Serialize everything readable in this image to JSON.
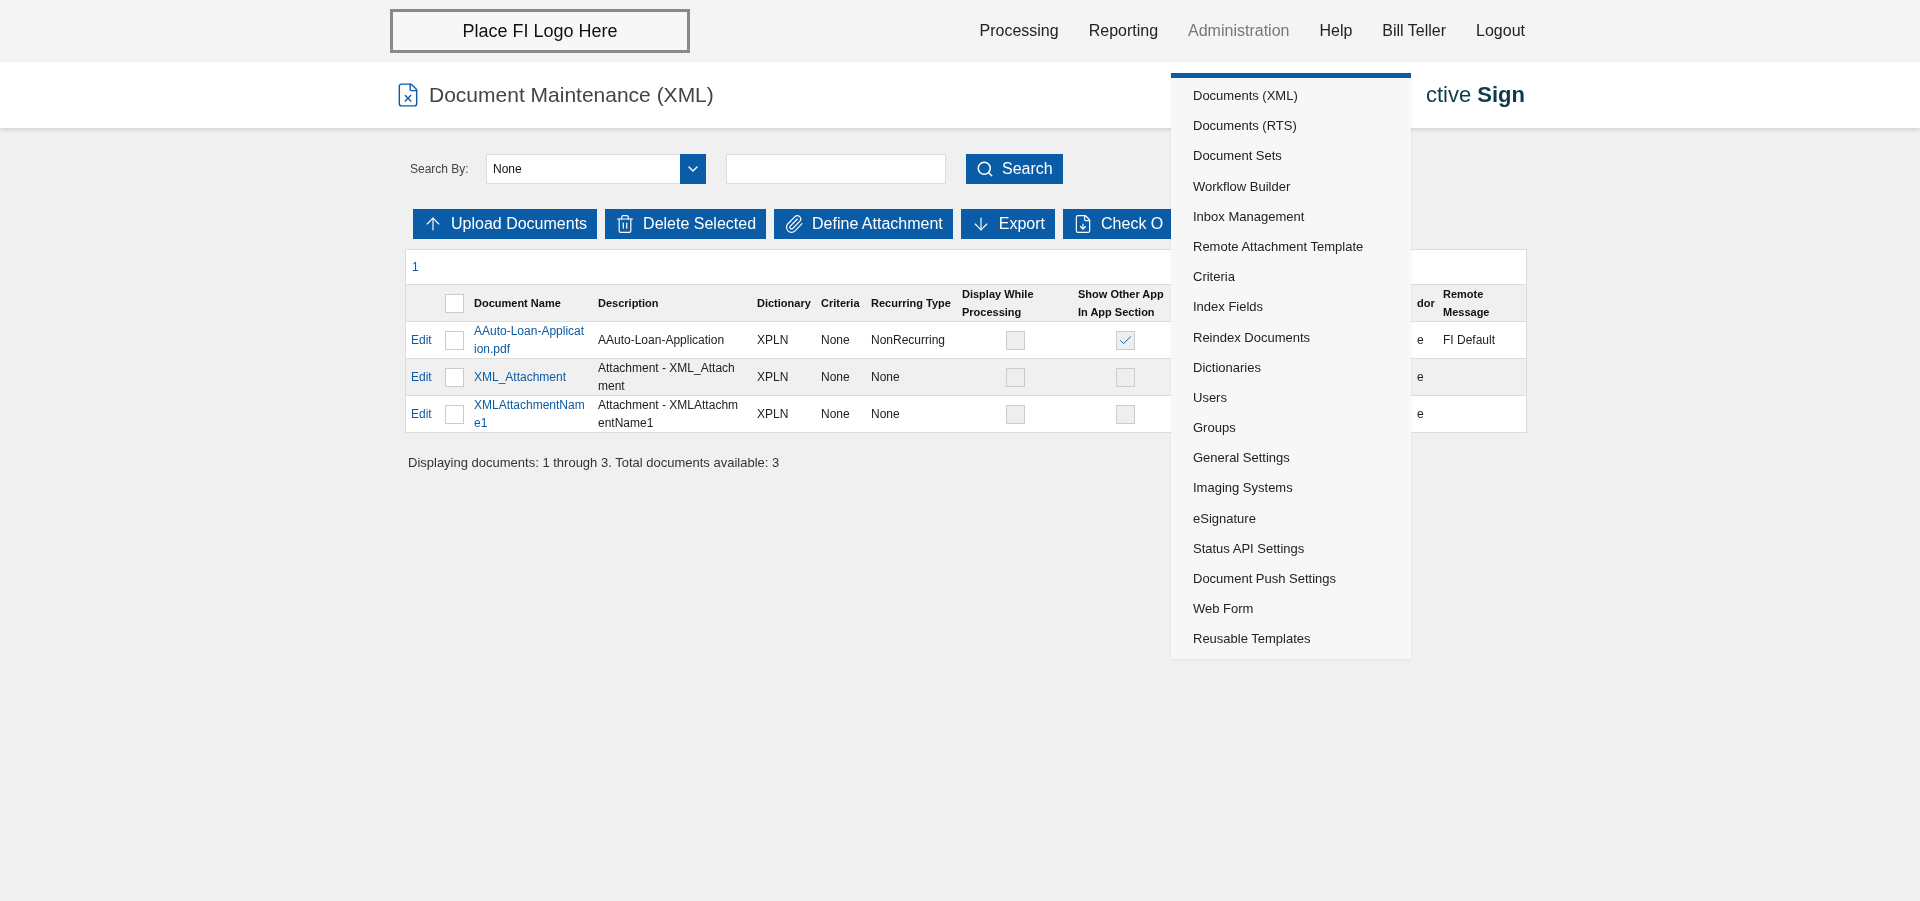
{
  "header": {
    "logo_text": "Place FI Logo Here",
    "nav": [
      {
        "label": "Processing",
        "selected": false
      },
      {
        "label": "Reporting",
        "selected": false
      },
      {
        "label": "Administration",
        "selected": true
      },
      {
        "label": "Help",
        "selected": false
      },
      {
        "label": "Bill Teller",
        "selected": false
      },
      {
        "label": "Logout",
        "selected": false
      }
    ]
  },
  "title_bar": {
    "title": "Document Maintenance (XML)",
    "brand": "ctive **Sign**"
  },
  "search": {
    "label": "Search By:",
    "select_value": "None",
    "button": "Search"
  },
  "toolbar": [
    {
      "label": "Upload Documents",
      "kind": "upload"
    },
    {
      "label": "Delete Selected",
      "kind": "delete"
    },
    {
      "label": "Define Attachment",
      "kind": "attach"
    },
    {
      "label": "Export",
      "kind": "export"
    },
    {
      "label": "Check O",
      "kind": "checkout"
    }
  ],
  "table": {
    "pager": "1",
    "select_all_checked": false,
    "columns": [
      "Document Name",
      "Description",
      "Dictionary",
      "Criteria",
      "Recurring Type",
      "Display While Processing",
      "Show Other App In App Section",
      "dor",
      "Remote Message"
    ],
    "rows": [
      {
        "edit": "Edit",
        "checked": false,
        "name": "AAuto-Loan-Applicat ion.pdf",
        "description": "AAuto-Loan-Application",
        "dictionary": "XPLN",
        "criteria": "None",
        "recurring_type": "NonRecurring",
        "display_while_processing": false,
        "show_other_app": true,
        "column_10": "e",
        "remote_message": "FI Default"
      },
      {
        "edit": "Edit",
        "checked": false,
        "name": "XML_Attachment",
        "description": "Attachment - XML_Attach ment",
        "dictionary": "XPLN",
        "criteria": "None",
        "recurring_type": "None",
        "display_while_processing": false,
        "show_other_app": false,
        "column_10": "e"
      },
      {
        "edit": "Edit",
        "checked": false,
        "name": "XMLAttachmentNam e1",
        "description": "Attachment - XMLAttachm entName1",
        "dictionary": "XPLN",
        "criteria": "None",
        "recurring_type": "None",
        "display_while_processing": false,
        "show_other_app": false,
        "column_10": "e"
      }
    ]
  },
  "status": "Displaying documents: 1 through 3. Total documents available: 3",
  "admin_menu": {
    "items": [
      "Documents (XML)",
      "Documents (RTS)",
      "Document Sets",
      "Workflow Builder",
      "Inbox Management",
      "Remote Attachment Template",
      "Criteria",
      "Index Fields",
      "Reindex Documents",
      "Dictionaries",
      "Users",
      "Groups",
      "General Settings",
      "Imaging Systems",
      "eSignature",
      "Status API Settings",
      "Document Push Settings",
      "Web Form",
      "Reusable Templates"
    ]
  }
}
